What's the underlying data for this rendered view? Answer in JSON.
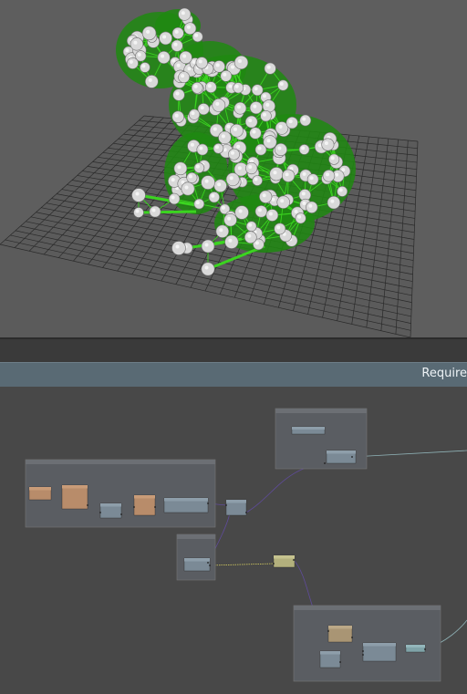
{
  "graph_header": {
    "title": "Require"
  },
  "viewport": {
    "object": "frog-mesh",
    "mesh_color": "#3bd420",
    "sphere_color": "#d9d9d9",
    "grid_color": "#2a2a2a",
    "background": "#5e5e5e"
  },
  "node_graph": {
    "background": "#484848",
    "colors": {
      "frame": "#5a5d62",
      "node_orange": "#b88c6a",
      "node_blue": "#7b8a96",
      "node_yellow": "#b3b07d",
      "node_tan": "#a99574",
      "wire_purple": "#5f4b9a",
      "wire_yellow": "#d8d060",
      "wire_teal": "#8fb2b6"
    }
  }
}
